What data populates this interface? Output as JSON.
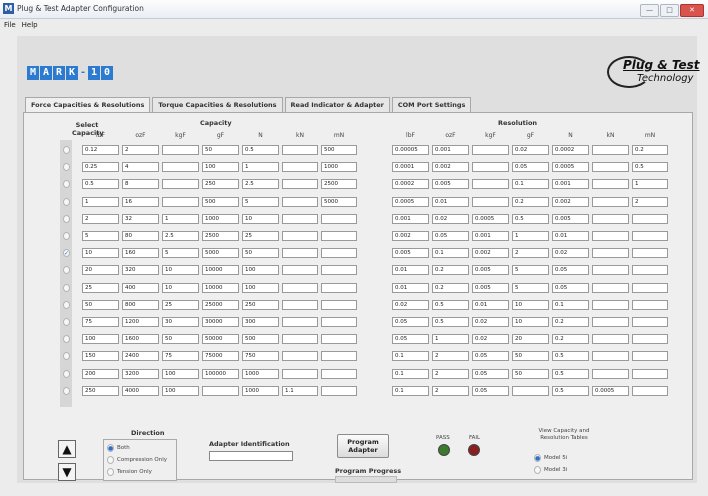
{
  "window": {
    "title": "Plug & Test Adapter Configuration",
    "min": "—",
    "max": "□",
    "close": "✕"
  },
  "menu": [
    "File",
    "Help"
  ],
  "tabs": [
    "Force Capacities & Resolutions",
    "Torque Capacities & Resolutions",
    "Read Indicator & Adapter",
    "COM Port Settings"
  ],
  "left_title": "Capacity",
  "right_title": "Resolution",
  "select_label": "Select Capacity",
  "units": [
    "lbF",
    "ozF",
    "kgF",
    "gF",
    "N",
    "kN",
    "mN"
  ],
  "capacity_rows": [
    [
      "0.12",
      "2",
      "",
      "50",
      "0.5",
      "",
      "500"
    ],
    [
      "0.25",
      "4",
      "",
      "100",
      "1",
      "",
      "1000"
    ],
    [
      "0.5",
      "8",
      "",
      "250",
      "2.5",
      "",
      "2500"
    ],
    [
      "1",
      "16",
      "",
      "500",
      "5",
      "",
      "5000"
    ],
    [
      "2",
      "32",
      "1",
      "1000",
      "10",
      "",
      ""
    ],
    [
      "5",
      "80",
      "2.5",
      "2500",
      "25",
      "",
      ""
    ],
    [
      "10",
      "160",
      "5",
      "5000",
      "50",
      "",
      ""
    ],
    [
      "20",
      "320",
      "10",
      "10000",
      "100",
      "",
      ""
    ],
    [
      "25",
      "400",
      "10",
      "10000",
      "100",
      "",
      ""
    ],
    [
      "50",
      "800",
      "25",
      "25000",
      "250",
      "",
      ""
    ],
    [
      "75",
      "1200",
      "30",
      "30000",
      "300",
      "",
      ""
    ],
    [
      "100",
      "1600",
      "50",
      "50000",
      "500",
      "",
      ""
    ],
    [
      "150",
      "2400",
      "75",
      "75000",
      "750",
      "",
      ""
    ],
    [
      "200",
      "3200",
      "100",
      "100000",
      "1000",
      "",
      ""
    ],
    [
      "250",
      "4000",
      "100",
      "",
      "1000",
      "1.1",
      ""
    ]
  ],
  "resolution_rows": [
    [
      "0.00005",
      "0.001",
      "",
      "0.02",
      "0.0002",
      "",
      "0.2"
    ],
    [
      "0.0001",
      "0.002",
      "",
      "0.05",
      "0.0005",
      "",
      "0.5"
    ],
    [
      "0.0002",
      "0.005",
      "",
      "0.1",
      "0.001",
      "",
      "1"
    ],
    [
      "0.0005",
      "0.01",
      "",
      "0.2",
      "0.002",
      "",
      "2"
    ],
    [
      "0.001",
      "0.02",
      "0.0005",
      "0.5",
      "0.005",
      "",
      ""
    ],
    [
      "0.002",
      "0.05",
      "0.001",
      "1",
      "0.01",
      "",
      ""
    ],
    [
      "0.005",
      "0.1",
      "0.002",
      "2",
      "0.02",
      "",
      ""
    ],
    [
      "0.01",
      "0.2",
      "0.005",
      "5",
      "0.05",
      "",
      ""
    ],
    [
      "0.01",
      "0.2",
      "0.005",
      "5",
      "0.05",
      "",
      ""
    ],
    [
      "0.02",
      "0.5",
      "0.01",
      "10",
      "0.1",
      "",
      ""
    ],
    [
      "0.05",
      "0.5",
      "0.02",
      "10",
      "0.2",
      "",
      ""
    ],
    [
      "0.05",
      "1",
      "0.02",
      "20",
      "0.2",
      "",
      ""
    ],
    [
      "0.1",
      "2",
      "0.05",
      "50",
      "0.5",
      "",
      ""
    ],
    [
      "0.1",
      "2",
      "0.05",
      "50",
      "0.5",
      "",
      ""
    ],
    [
      "0.1",
      "2",
      "0.05",
      "",
      "0.5",
      "0.0005",
      ""
    ]
  ],
  "selected_row": 6,
  "direction": {
    "title": "Direction",
    "options": [
      "Both",
      "Compression Only",
      "Tension Only"
    ],
    "selected": 0
  },
  "adapter_id": {
    "label": "Adapter Identification",
    "value": ""
  },
  "program": {
    "button": "Program Adapter",
    "progress_label": "Program Progress",
    "progress": 0
  },
  "status": {
    "pass_label": "PASS",
    "fail_label": "FAIL",
    "pass_color": "#3d7a2e",
    "fail_color": "#8a1f1f"
  },
  "model_view": {
    "title": "View Capacity and Resolution Tables",
    "options": [
      "Model 5i",
      "Model 3i"
    ],
    "selected": 0
  },
  "brand": {
    "logo": "MARK-10",
    "pt_line1": "Plug & Test",
    "pt_line2": "Technology"
  }
}
